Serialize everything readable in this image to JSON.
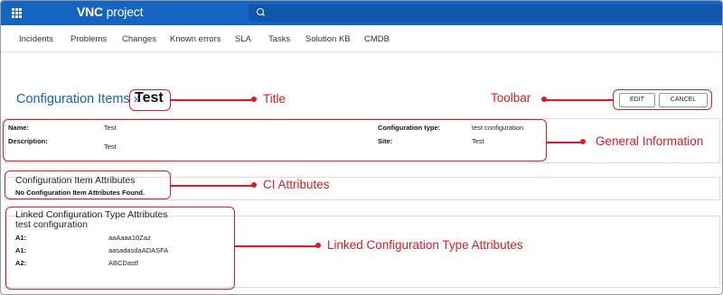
{
  "app": {
    "logo_bold": "VNC",
    "logo_rest": " project"
  },
  "nav": [
    "Incidents",
    "Problems",
    "Changes",
    "Known errors",
    "SLA",
    "Tasks",
    "Solution KB",
    "CMDB"
  ],
  "page": {
    "breadcrumb": "Configuration Items »",
    "title": "Test"
  },
  "toolbar": {
    "edit_label": "EDIT",
    "cancel_label": "CANCEL"
  },
  "general": {
    "name_label": "Name:",
    "name_value": "Test",
    "description_label": "Description:",
    "description_value": "Test",
    "type_label": "Configuration type:",
    "type_value": "test configuration",
    "site_label": "Site:",
    "site_value": "Test"
  },
  "ci_attributes": {
    "title": "Configuration Item Attributes",
    "empty_message": "No Configuration Item Attributes Found."
  },
  "linked_attributes": {
    "title": "Linked Configuration Type Attributes",
    "subtitle": "test configuration",
    "rows": [
      {
        "label": "A1:",
        "value": "aaAaaa10Zaz"
      },
      {
        "label": "A1:",
        "value": "aasadasdaADASFA"
      },
      {
        "label": "A2:",
        "value": "ABCDastf"
      }
    ]
  },
  "annotations": {
    "title": "Title",
    "toolbar": "Toolbar",
    "general": "General Information",
    "ci": "CI Attributes",
    "linked": "Linked Configuration Type Attributes"
  },
  "colors": {
    "brand": "#1565c0",
    "annotation": "#e01b24"
  }
}
